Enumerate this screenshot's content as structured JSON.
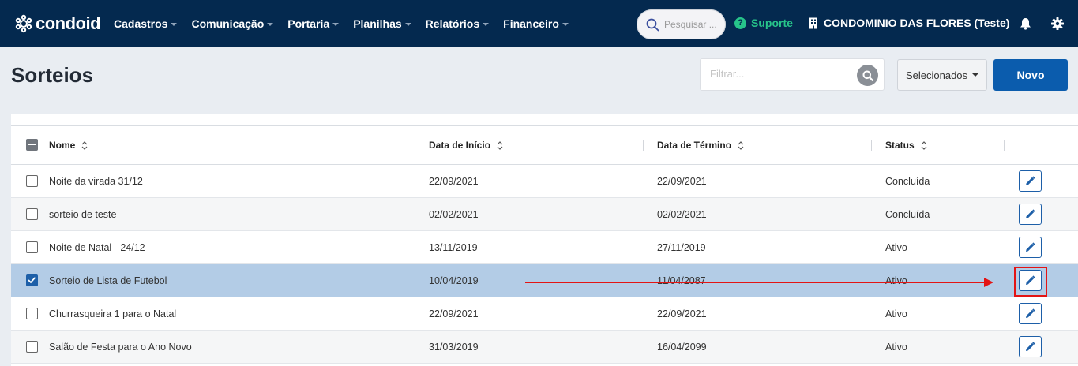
{
  "app": {
    "logo_text": "condoid"
  },
  "nav": {
    "menu": [
      {
        "label": "Cadastros"
      },
      {
        "label": "Comunicação"
      },
      {
        "label": "Portaria"
      },
      {
        "label": "Planilhas"
      },
      {
        "label": "Relatórios"
      },
      {
        "label": "Financeiro"
      }
    ],
    "search_placeholder": "Pesquisar ...",
    "support_label": "Suporte",
    "condominium_label": "CONDOMINIO DAS FLORES (Teste)"
  },
  "page": {
    "title": "Sorteios",
    "filter_placeholder": "Filtrar...",
    "selected_dropdown_label": "Selecionados",
    "new_button_label": "Novo"
  },
  "table": {
    "columns": [
      "Nome",
      "Data de Início",
      "Data de Término",
      "Status"
    ],
    "rows": [
      {
        "name": "Noite da virada 31/12",
        "start": "22/09/2021",
        "end": "22/09/2021",
        "status": "Concluída",
        "checked": false
      },
      {
        "name": "sorteio de teste",
        "start": "02/02/2021",
        "end": "02/02/2021",
        "status": "Concluída",
        "checked": false
      },
      {
        "name": "Noite de Natal - 24/12",
        "start": "13/11/2019",
        "end": "27/11/2019",
        "status": "Ativo",
        "checked": false
      },
      {
        "name": "Sorteio de Lista de Futebol",
        "start": "10/04/2019",
        "end": "11/04/2087",
        "status": "Ativo",
        "checked": true
      },
      {
        "name": "Churrasqueira 1 para o Natal",
        "start": "22/09/2021",
        "end": "22/09/2021",
        "status": "Ativo",
        "checked": false
      },
      {
        "name": "Salão de Festa para o Ano Novo",
        "start": "31/03/2019",
        "end": "16/04/2099",
        "status": "Ativo",
        "checked": false
      }
    ]
  },
  "colors": {
    "navbar": "#04294f",
    "primary": "#0b5cad",
    "support": "#27c48a",
    "selected_row": "#b3cce6",
    "annotation": "#e31414"
  },
  "icons": {
    "logo": "condoid-logo-icon",
    "search": "search-icon",
    "support": "help-circle-icon",
    "building": "building-icon",
    "bell": "bell-icon",
    "settings": "gear-icon",
    "sort": "sort-icon",
    "edit": "pencil-icon"
  }
}
